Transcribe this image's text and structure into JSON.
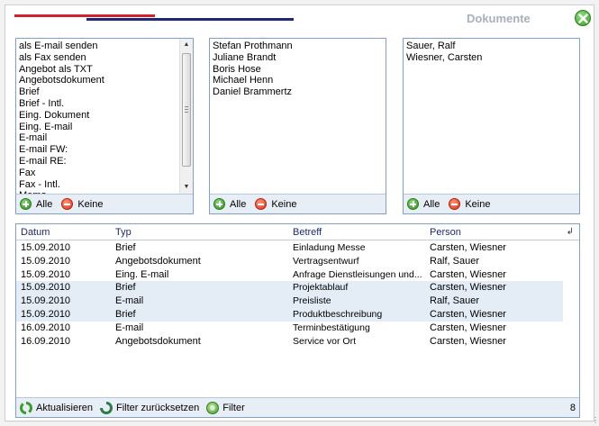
{
  "header": {
    "title": "Dokumente"
  },
  "colors": {
    "accent_red": "#d1222f",
    "accent_blue": "#1e2a78",
    "panel_border": "#7fa0c8"
  },
  "type_panel": {
    "items": [
      "als E-mail senden",
      "als Fax senden",
      "Angebot als TXT",
      "Angebotsdokument",
      "Brief",
      "Brief - Intl.",
      "Eing. Dokument",
      "Eing. E-mail",
      "E-mail",
      "E-mail FW:",
      "E-mail RE:",
      "Fax",
      "Fax - Intl.",
      "Memo"
    ],
    "all_label": "Alle",
    "none_label": "Keine"
  },
  "persons_panel": {
    "items": [
      "Stefan Prothmann",
      "Juliane Brandt",
      "Boris Hose",
      "Michael Henn",
      "Daniel Brammertz"
    ],
    "all_label": "Alle",
    "none_label": "Keine"
  },
  "contacts_panel": {
    "items": [
      "Sauer, Ralf",
      "Wiesner, Carsten"
    ],
    "all_label": "Alle",
    "none_label": "Keine"
  },
  "grid": {
    "columns": {
      "datum": "Datum",
      "typ": "Typ",
      "betreff": "Betreff",
      "person": "Person"
    },
    "rows": [
      {
        "datum": "15.09.2010",
        "typ": "Brief",
        "betreff": "Einladung Messe",
        "person": "Carsten, Wiesner"
      },
      {
        "datum": "15.09.2010",
        "typ": "Angebotsdokument",
        "betreff": "Vertragsentwurf",
        "person": "Ralf, Sauer"
      },
      {
        "datum": "15.09.2010",
        "typ": "Eing. E-mail",
        "betreff": "Anfrage Dienstleisungen und...",
        "person": "Carsten, Wiesner"
      },
      {
        "datum": "15.09.2010",
        "typ": "Brief",
        "betreff": "Projektablauf",
        "person": "Carsten, Wiesner"
      },
      {
        "datum": "15.09.2010",
        "typ": "E-mail",
        "betreff": "Preisliste",
        "person": "Ralf, Sauer"
      },
      {
        "datum": "15.09.2010",
        "typ": "Brief",
        "betreff": "Produktbeschreibung",
        "person": "Carsten, Wiesner"
      },
      {
        "datum": "16.09.2010",
        "typ": "E-mail",
        "betreff": "Terminbestätigung",
        "person": "Carsten, Wiesner"
      },
      {
        "datum": "16.09.2010",
        "typ": "Angebotsdokument",
        "betreff": "Service vor Ort",
        "person": "Carsten, Wiesner"
      }
    ],
    "selected_rows": [
      3,
      4,
      5
    ],
    "footer": {
      "refresh_label": "Aktualisieren",
      "reset_label": "Filter zurücksetzen",
      "filter_label": "Filter",
      "count": "8"
    }
  }
}
